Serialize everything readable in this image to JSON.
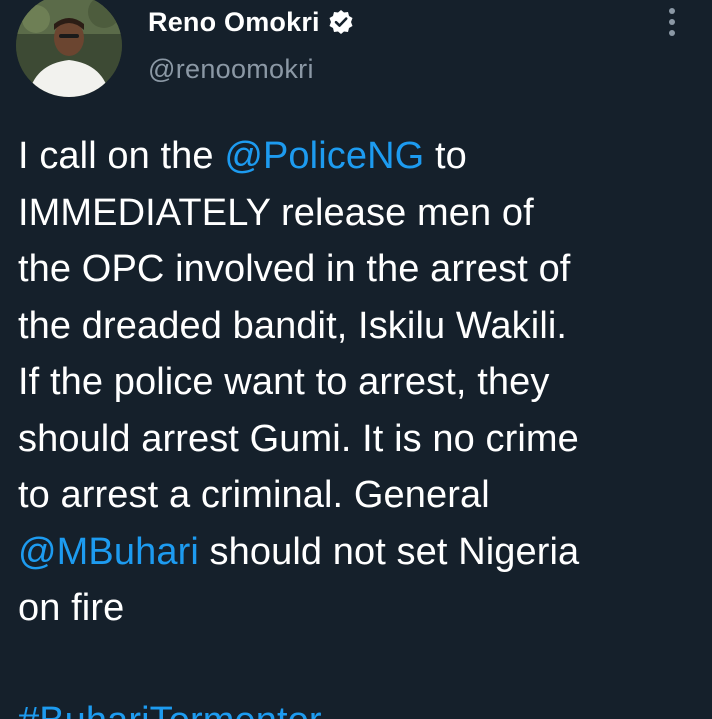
{
  "author": {
    "display_name": "Reno Omokri",
    "handle": "@renoomokri",
    "verified": true,
    "avatar_icon": "profile-photo-icon"
  },
  "menu": {
    "icon": "more-options-icon"
  },
  "tweet": {
    "lines": [
      {
        "before": "I call on the ",
        "mention": "@PoliceNG",
        "after": " to"
      },
      {
        "text": "IMMEDIATELY release men of"
      },
      {
        "text": "the OPC involved in the arrest of"
      },
      {
        "text": "the dreaded bandit, Iskilu Wakili."
      },
      {
        "text": "If the police want to arrest, they"
      },
      {
        "text": "should arrest Gumi. It is no crime"
      },
      {
        "text": "to arrest a criminal. General"
      },
      {
        "mention": "@MBuhari",
        "after": " should not set Nigeria"
      },
      {
        "text": "on fire"
      }
    ],
    "hashtag": "#BuhariTormentor"
  },
  "colors": {
    "background": "#15202b",
    "text": "#ffffff",
    "secondary": "#8b98a5",
    "link": "#1d9bf0"
  }
}
